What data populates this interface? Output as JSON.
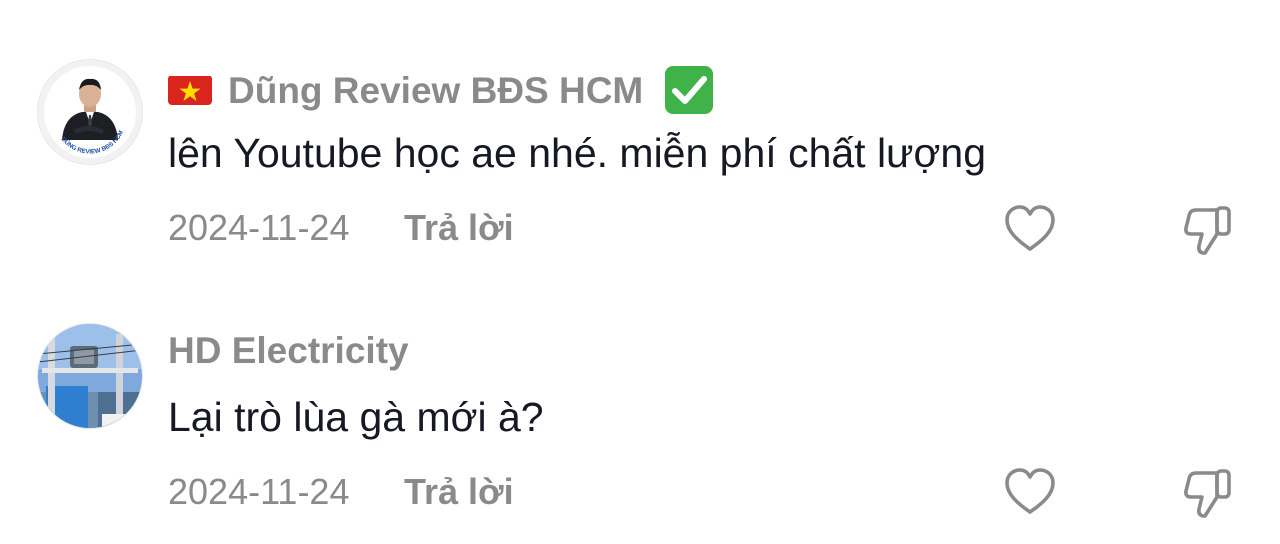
{
  "comments": [
    {
      "username": "Dũng Review BĐS HCM",
      "flag_icon": "vietnam-flag-icon",
      "verified_icon": "check-mark-button-icon",
      "avatar_caption": "DŨNG REVIEW BĐS HCM",
      "text": "lên Youtube học ae nhé. miễn phí chất lượng",
      "date": "2024-11-24",
      "reply_label": "Trả lời",
      "like_icon": "heart-outline-icon",
      "dislike_icon": "thumbs-down-outline-icon"
    },
    {
      "username": "HD Electricity",
      "text": "Lại trò lùa gà mới à?",
      "date": "2024-11-24",
      "reply_label": "Trả lời",
      "like_icon": "heart-outline-icon",
      "dislike_icon": "thumbs-down-outline-icon"
    }
  ],
  "colors": {
    "username": "#8a8a8a",
    "body_text": "#161823",
    "meta": "#8a8a8a",
    "verified": "#3fb24a",
    "flag_red": "#da251d",
    "flag_star": "#ffde00"
  }
}
